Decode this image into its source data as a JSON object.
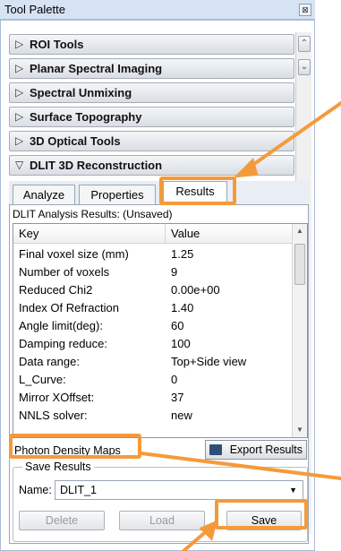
{
  "window": {
    "title": "Tool Palette",
    "close_glyph": "⊠"
  },
  "accordion": [
    {
      "label": "ROI Tools",
      "expanded": false
    },
    {
      "label": "Planar Spectral Imaging",
      "expanded": false
    },
    {
      "label": "Spectral Unmixing",
      "expanded": false
    },
    {
      "label": "Surface Topography",
      "expanded": false
    },
    {
      "label": "3D Optical Tools",
      "expanded": false
    },
    {
      "label": "DLIT 3D Reconstruction",
      "expanded": true
    }
  ],
  "glyphs": {
    "collapsed": "▷",
    "expanded": "▽"
  },
  "tabs": [
    {
      "label": "Analyze",
      "active": false
    },
    {
      "label": "Properties",
      "active": false
    },
    {
      "label": "Results",
      "active": true
    }
  ],
  "results": {
    "title": "DLIT Analysis Results: (Unsaved)",
    "columns": {
      "key": "Key",
      "value": "Value"
    },
    "rows": [
      {
        "key": "Final voxel size (mm)",
        "value": "1.25"
      },
      {
        "key": "Number of voxels",
        "value": "9"
      },
      {
        "key": "Reduced Chi2",
        "value": "0.00e+00"
      },
      {
        "key": "Index Of Refraction",
        "value": "1.40"
      },
      {
        "key": "Angle limit(deg):",
        "value": "60"
      },
      {
        "key": "Damping reduce:",
        "value": "100"
      },
      {
        "key": "Data range:",
        "value": "Top+Side view"
      },
      {
        "key": "L_Curve:",
        "value": "0"
      },
      {
        "key": "Mirror XOffset:",
        "value": "37"
      },
      {
        "key": "NNLS solver:",
        "value": "new"
      }
    ],
    "photon_density_label": "Photon Density Maps",
    "export_label": "Export Results"
  },
  "save_results": {
    "group_title": "Save Results",
    "name_label": "Name:",
    "name_value": "DLIT_1",
    "delete_label": "Delete",
    "load_label": "Load",
    "save_label": "Save"
  },
  "colors": {
    "annotation": "#f59a3b"
  }
}
